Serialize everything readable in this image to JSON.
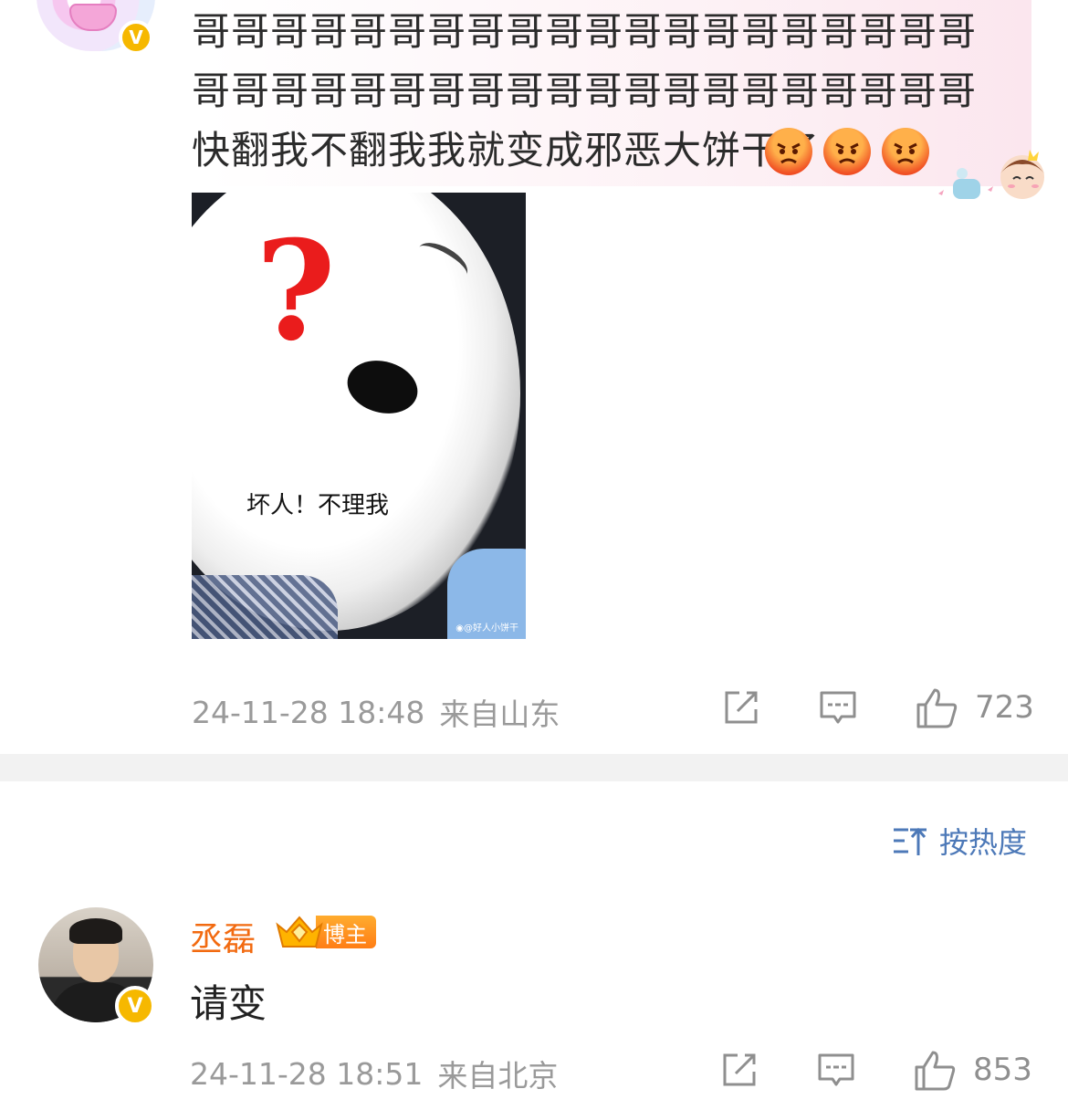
{
  "post": {
    "text": "哥哥哥哥哥哥哥哥哥哥哥哥哥哥哥哥哥哥哥哥哥哥哥哥哥哥哥哥哥哥哥哥哥哥哥哥哥哥哥哥快翻我不翻我我就变成邪恶大饼干了",
    "emoji_count": 3,
    "image": {
      "overlay_symbol": "?",
      "caption": "坏人！不理我",
      "watermark": "◉@好人小饼干"
    },
    "timestamp": "24-11-28 18:48",
    "location": "来自山东",
    "like_count": "723"
  },
  "sort": {
    "label": "按热度"
  },
  "reply": {
    "author": "丞磊",
    "badge": "博主",
    "text": "请变",
    "timestamp": "24-11-28 18:51",
    "location": "来自北京",
    "like_count": "853"
  },
  "icons": {
    "verified": "V",
    "share": "share-icon",
    "comment": "comment-icon",
    "like": "thumbs-up-icon",
    "sort": "sort-icon"
  },
  "colors": {
    "author_name": "#f26a10",
    "sort_link": "#4d79b8",
    "verified_badge": "#f6b800",
    "meta_text": "#9a9a9a"
  }
}
